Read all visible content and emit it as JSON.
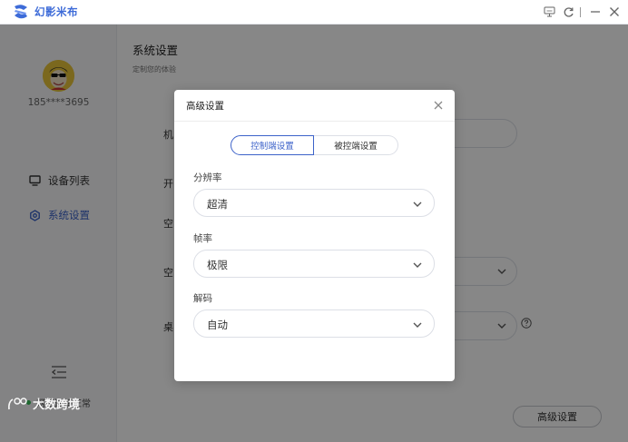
{
  "app": {
    "brand_name": "幻影米布",
    "brand_color": "#3d6bd8"
  },
  "sidebar": {
    "user_phone": "185****3695",
    "items": [
      {
        "label": "设备列表",
        "icon": "monitor-icon"
      },
      {
        "label": "系统设置",
        "icon": "gear-icon",
        "active": true
      }
    ],
    "net_status": "网络连接正常",
    "net_status_color": "#37c25a"
  },
  "main": {
    "title": "系统设置",
    "subtitle": "定制您的体验",
    "rows": [
      {
        "label": "机"
      },
      {
        "label": "开"
      },
      {
        "label": "空"
      },
      {
        "label": "空"
      },
      {
        "label": "桌"
      }
    ],
    "advanced_button": "高级设置"
  },
  "modal": {
    "title": "高级设置",
    "tabs": [
      {
        "label": "控制端设置",
        "active": true
      },
      {
        "label": "被控端设置",
        "active": false
      }
    ],
    "fields": [
      {
        "label": "分辨率",
        "value": "超清"
      },
      {
        "label": "帧率",
        "value": "极限"
      },
      {
        "label": "解码",
        "value": "自动"
      }
    ],
    "accent_color": "#3c62c9"
  },
  "watermark": {
    "text": "大数跨境"
  }
}
